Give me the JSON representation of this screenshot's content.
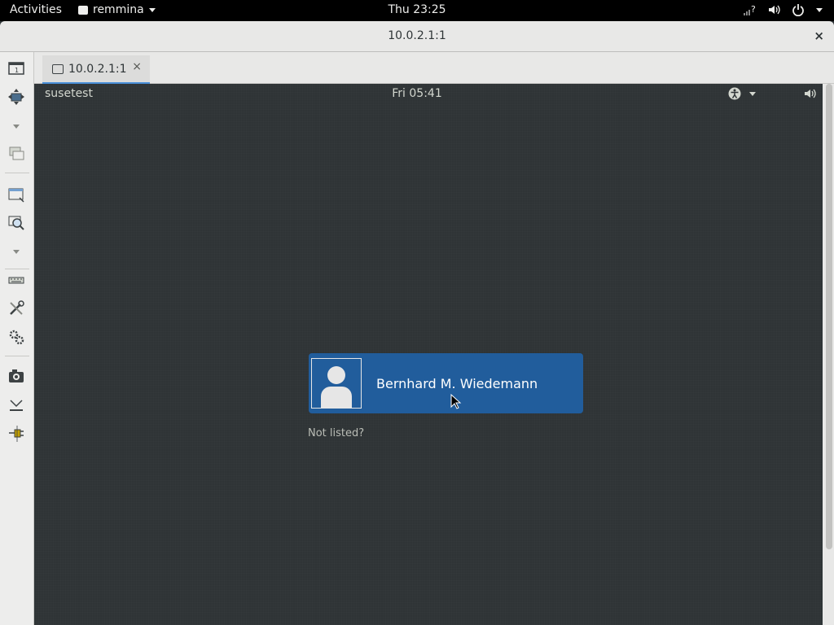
{
  "topbar": {
    "activities": "Activities",
    "app_name": "remmina",
    "clock": "Thu 23:25"
  },
  "window": {
    "title": "10.0.2.1:1",
    "close": "×"
  },
  "tab": {
    "label": "10.0.2.1:1",
    "close": "×"
  },
  "remote": {
    "hostname": "susetest",
    "clock": "Fri 05:41",
    "user_name": "Bernhard M. Wiedemann",
    "not_listed": "Not listed?"
  },
  "toolbar_icons": [
    "viewport-icon",
    "fit-window-icon",
    "chevron-down-icon",
    "multi-monitor-icon",
    "window-resize-icon",
    "zoom-icon",
    "chevron-down-icon",
    "keyboard-icon",
    "tools-icon",
    "preferences-icon",
    "screenshot-icon",
    "minimize-icon",
    "disconnect-icon"
  ],
  "colors": {
    "accent": "#215d9c",
    "tab_indicator": "#4a90d9",
    "remote_bg": "#2f3436"
  }
}
